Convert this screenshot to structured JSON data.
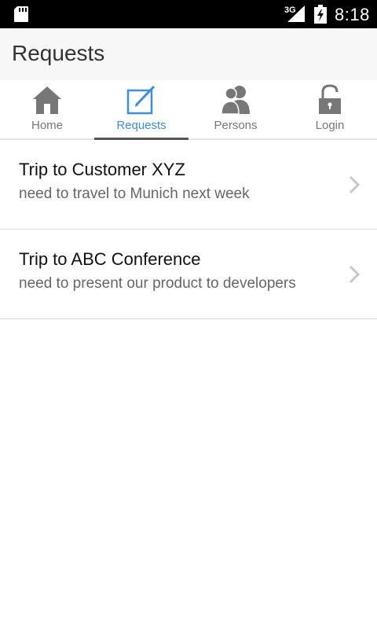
{
  "status_bar": {
    "network": "3G",
    "time": "8:18"
  },
  "header": {
    "title": "Requests"
  },
  "tabs": [
    {
      "label": "Home",
      "icon": "home-icon"
    },
    {
      "label": "Requests",
      "icon": "edit-icon",
      "active": true
    },
    {
      "label": "Persons",
      "icon": "persons-icon"
    },
    {
      "label": "Login",
      "icon": "unlock-icon"
    }
  ],
  "requests": [
    {
      "title": "Trip to Customer XYZ",
      "subtitle": "need to travel to Munich next week"
    },
    {
      "title": "Trip to ABC Conference",
      "subtitle": "need to present our product to developers"
    }
  ],
  "colors": {
    "accent": "#3f8ed8",
    "inactive": "#777777"
  }
}
